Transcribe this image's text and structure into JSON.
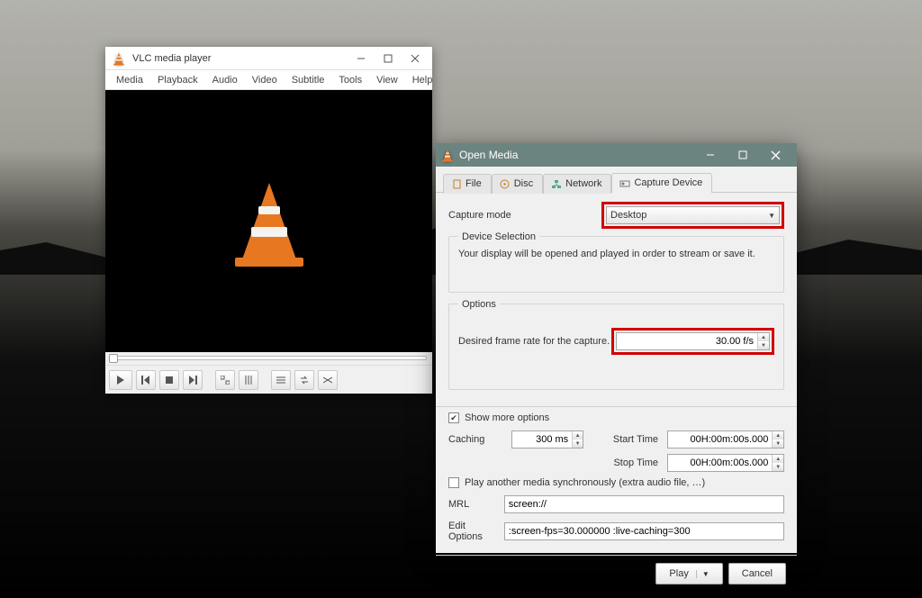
{
  "vlc": {
    "title": "VLC media player",
    "menu": [
      "Media",
      "Playback",
      "Audio",
      "Video",
      "Subtitle",
      "Tools",
      "View",
      "Help"
    ]
  },
  "dialog": {
    "title": "Open Media",
    "tabs": {
      "file": "File",
      "disc": "Disc",
      "network": "Network",
      "capture": "Capture Device"
    },
    "capture_mode_label": "Capture mode",
    "capture_mode_value": "Desktop",
    "device_selection": {
      "legend": "Device Selection",
      "text": "Your display will be opened and played in order to stream or save it."
    },
    "options": {
      "legend": "Options",
      "fps_label": "Desired frame rate for the capture.",
      "fps_value": "30.00 f/s"
    },
    "show_more_label": "Show more options",
    "caching_label": "Caching",
    "caching_value": "300 ms",
    "start_time_label": "Start Time",
    "start_time_value": "00H:00m:00s.000",
    "stop_time_label": "Stop Time",
    "stop_time_value": "00H:00m:00s.000",
    "sync_label": "Play another media synchronously (extra audio file, …)",
    "mrl_label": "MRL",
    "mrl_value": "screen://",
    "edit_options_label": "Edit Options",
    "edit_options_value": ":screen-fps=30.000000 :live-caching=300",
    "play_label": "Play",
    "cancel_label": "Cancel"
  }
}
